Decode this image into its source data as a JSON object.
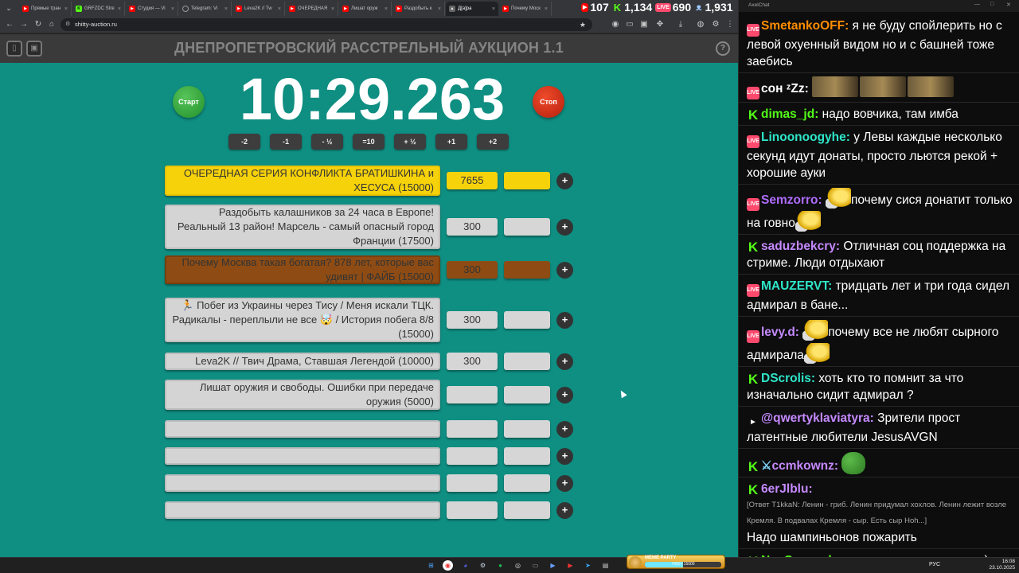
{
  "browser": {
    "tabs": [
      {
        "icon": "youtube",
        "label": "Прямые тран"
      },
      {
        "icon": "kick",
        "label": "GRFZDC Stre"
      },
      {
        "icon": "youtube",
        "label": "Студия — Vi"
      },
      {
        "icon": "telegram",
        "label": "Telegram: Vi"
      },
      {
        "icon": "youtube",
        "label": "Leva2K // Tw"
      },
      {
        "icon": "youtube",
        "label": "ОЧЕРЕДНАЯ"
      },
      {
        "icon": "youtube",
        "label": "Лишат оруж"
      },
      {
        "icon": "youtube",
        "label": "Раздобыть к"
      },
      {
        "icon": "site",
        "label": "Д[а]ра"
      },
      {
        "icon": "youtube",
        "label": "Почему Моск"
      }
    ],
    "url": "shitty-auction.ru"
  },
  "stream_counters": {
    "youtube": "107",
    "kick": "1,134",
    "live": "690",
    "total": "1,931"
  },
  "auction": {
    "title": "ДНЕПРОПЕТРОВСКИЙ РАССТРЕЛЬНЫЙ АУКЦИОН 1.1",
    "timer": "10:29.263",
    "start_label": "Старт",
    "stop_label": "Стоп",
    "adjust_buttons": [
      "-2",
      "-1",
      "- ½",
      "=10",
      "+ ½",
      "+1",
      "+2"
    ],
    "add_label": "+",
    "lots": [
      {
        "name": "ОЧЕРЕДНАЯ СЕРИЯ КОНФЛИКТА БРАТИШКИНА и ХЕСУСА (15000)",
        "amount": "7655",
        "color": "gold"
      },
      {
        "name": "Раздобыть калашников за 24 часа в Европе! Реальный 13 район! Марсель - самый опасный город Франции (17500)",
        "amount": "300",
        "color": "gray"
      },
      {
        "name": "Почему Москва такая богатая? 878 лет, которые вас удивят | ФАЙБ (15000)",
        "amount": "300",
        "color": "brown"
      },
      {
        "name": "🏃 Побег из Украины через Тису / Меня искали ТЦК. Радикалы - переплыли не все 🤯 / История побега 8/8 (15000)",
        "amount": "300",
        "color": "gray"
      },
      {
        "name": "Leva2K // Твич Драма, Ставшая Легендой (10000)",
        "amount": "300",
        "color": "gray"
      },
      {
        "name": "Лишат оружия и свободы. Ошибки при передаче оружия (5000)",
        "amount": "",
        "color": "gray"
      },
      {
        "name": "",
        "amount": "",
        "color": "gray"
      },
      {
        "name": "",
        "amount": "",
        "color": "gray"
      },
      {
        "name": "",
        "amount": "",
        "color": "gray"
      },
      {
        "name": "",
        "amount": "",
        "color": "gray"
      }
    ]
  },
  "chat": {
    "window_title": "AxelChat",
    "messages": [
      {
        "platform": "live",
        "nick": "SmetankoOFF",
        "nick_color": "#ff8c00",
        "text": "я не буду спойлерить но с левой охуенный видом но и с башней тоже заебись"
      },
      {
        "platform": "live",
        "nick": "сон ᶻZz",
        "nick_color": "#ffffff",
        "text": "",
        "emote": "meme-faces"
      },
      {
        "platform": "kick",
        "nick": "dimas_jd",
        "nick_color": "#53fc18",
        "text": "надо вовчика, там имба"
      },
      {
        "platform": "live",
        "nick": "Linoonoogyhe",
        "nick_color": "#2ee6c9",
        "text": "у Левы каждые несколько секунд идут донаты, просто льются рекой + хорошие ауки"
      },
      {
        "platform": "live",
        "nick": "Semzorro",
        "nick_color": "#b06cff",
        "text": "почему сися донатит только на говно",
        "emote": "coin"
      },
      {
        "platform": "kick",
        "nick": "saduzbekcry",
        "nick_color": "#c58aff",
        "text": "Отличная соц поддержка на стриме. Люди отдыхают"
      },
      {
        "platform": "live",
        "nick": "MAUZERVT",
        "nick_color": "#2ee6c9",
        "text": "тридцать лет и три года сидел адмирал в бане..."
      },
      {
        "platform": "live",
        "nick": "levy.d",
        "nick_color": "#c58aff",
        "text": "почему все не любят сырного адмирала",
        "emote": "coin"
      },
      {
        "platform": "kick",
        "nick": "DScrolis",
        "nick_color": "#2ee6c9",
        "text": "хоть кто то помнит за что изначально сидит адмирал ?"
      },
      {
        "platform": "youtube",
        "nick": "@qwertyklaviatyra",
        "nick_color": "#c58aff",
        "text": "Зрители прост латентные любители JesusAVGN"
      },
      {
        "platform": "kick",
        "nick": "ccmkownz",
        "nick_color": "#c58aff",
        "text": "",
        "emote": "pepe"
      },
      {
        "platform": "kick",
        "nick": "6erJlblu",
        "nick_color": "#c58aff",
        "reply": "[Ответ T1kkaN: Ленин - гриб. Ленин придумал хохлов. Ленин лежит возле Кремля. В подвалах Кремля - сыр. Есть сыр Hoh...]",
        "text": "Надо шампиньонов пожарить"
      },
      {
        "platform": "kick",
        "nick": "No_Seegnal",
        "nick_color": "#53fc18",
        "text": "чат по хисясу соскучился)"
      }
    ]
  },
  "taskbar": {
    "meme_party": {
      "title": "MEME PARTY",
      "value_text": "7450 / 15000",
      "progress": 0.5
    },
    "language": "РУС",
    "time": "16:08",
    "date": "23.10.2025"
  }
}
